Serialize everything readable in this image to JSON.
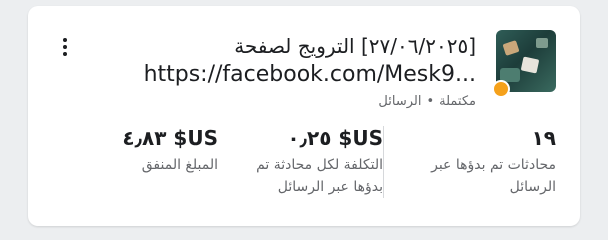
{
  "card": {
    "title": "[٢٧/٠٦/٢٠٢٥] الترويج لصفحة",
    "link": "https://facebook.com/Mesk9...",
    "status": "مكتملة",
    "separator": "•",
    "type": "الرسائل",
    "menu_icon": "more-vertical-icon",
    "status_color": "#f5a11b"
  },
  "metrics": [
    {
      "value": "١٩",
      "label": "محادثات تم بدؤها عبر الرسائل"
    },
    {
      "value": "US$ ٠٫٢٥",
      "label": "التكلفة لكل محادثة تم بدؤها عبر الرسائل"
    },
    {
      "value": "US$ ٤٫٨٣",
      "label": "المبلغ المنفق"
    }
  ]
}
